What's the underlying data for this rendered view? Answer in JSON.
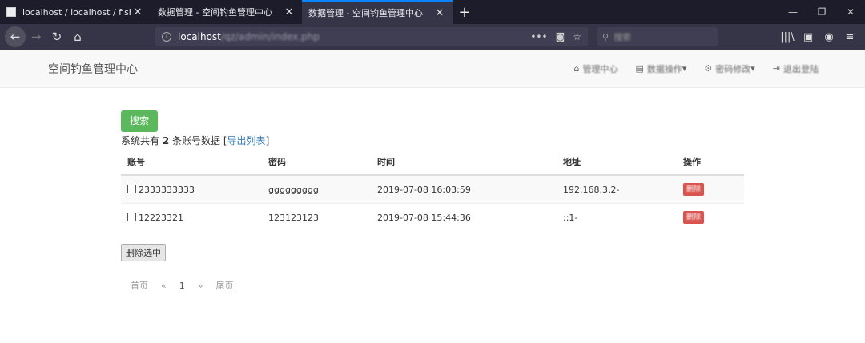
{
  "browser": {
    "tabs": [
      {
        "title": "localhost / localhost / fish /",
        "active": false
      },
      {
        "title": "数据管理 - 空间钓鱼管理中心",
        "active": false
      },
      {
        "title": "数据管理 - 空间钓鱼管理中心",
        "active": true
      }
    ],
    "url_host": "localhost",
    "url_path": "/qz/admin/index.php",
    "search_placeholder": "搜索"
  },
  "site": {
    "brand": "空间钓鱼管理中心",
    "nav": [
      {
        "label": "管理中心",
        "icon": "home-icon"
      },
      {
        "label": "数据操作",
        "icon": "list-icon",
        "caret": "▾"
      },
      {
        "label": "密码修改",
        "icon": "gear-icon",
        "caret": "▾"
      },
      {
        "label": "退出登陆",
        "icon": "logout-icon"
      }
    ]
  },
  "main": {
    "search_button": "搜索",
    "summary_prefix": "系统共有",
    "summary_count": "2",
    "summary_suffix": "条账号数据",
    "export_link": "导出列表",
    "columns": [
      "账号",
      "密码",
      "时间",
      "地址",
      "操作"
    ],
    "rows": [
      {
        "account": "2333333333",
        "password": "ggggggggg",
        "time": "2019-07-08 16:03:59",
        "address": "192.168.3.2-",
        "action": "删除"
      },
      {
        "account": "12223321",
        "password": "123123123",
        "time": "2019-07-08 15:44:36",
        "address": "::1-",
        "action": "删除"
      }
    ],
    "delete_selected": "删除选中",
    "pager": {
      "first": "首页",
      "prev": "«",
      "current": "1",
      "next": "»",
      "last": "尾页"
    }
  }
}
